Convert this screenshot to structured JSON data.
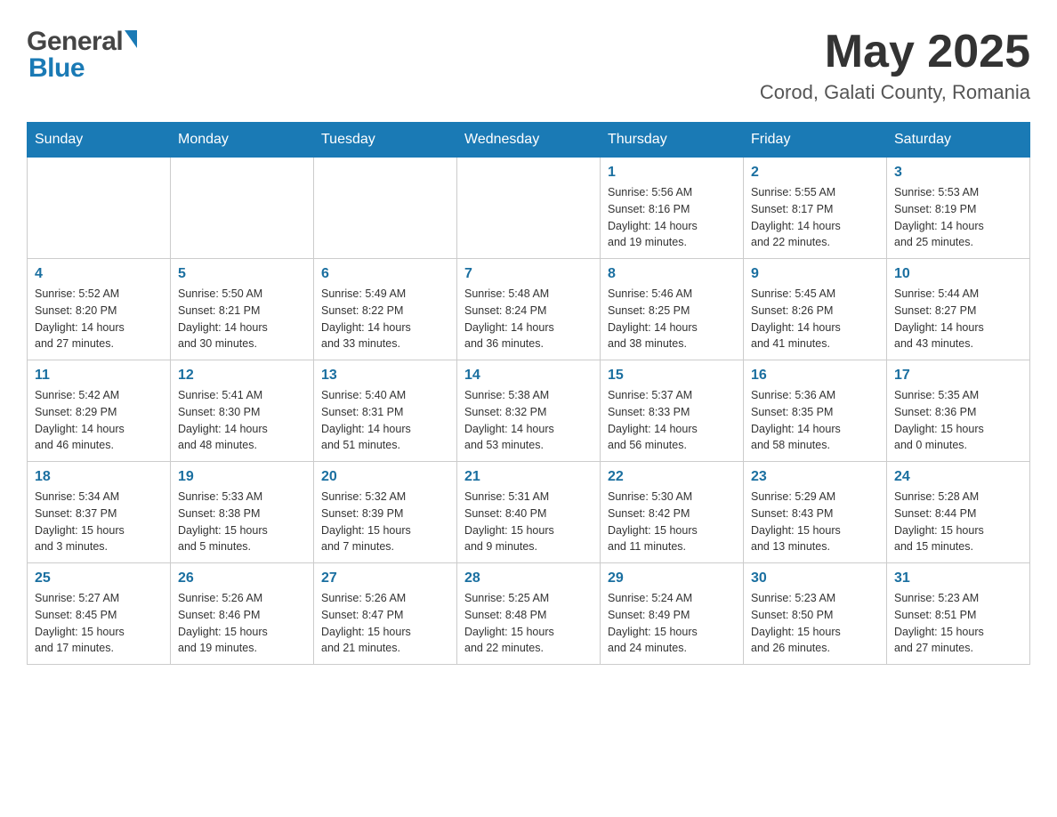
{
  "header": {
    "month_year": "May 2025",
    "location": "Corod, Galati County, Romania",
    "logo_general": "General",
    "logo_blue": "Blue"
  },
  "days_of_week": [
    "Sunday",
    "Monday",
    "Tuesday",
    "Wednesday",
    "Thursday",
    "Friday",
    "Saturday"
  ],
  "weeks": [
    [
      {
        "day": "",
        "info": ""
      },
      {
        "day": "",
        "info": ""
      },
      {
        "day": "",
        "info": ""
      },
      {
        "day": "",
        "info": ""
      },
      {
        "day": "1",
        "info": "Sunrise: 5:56 AM\nSunset: 8:16 PM\nDaylight: 14 hours\nand 19 minutes."
      },
      {
        "day": "2",
        "info": "Sunrise: 5:55 AM\nSunset: 8:17 PM\nDaylight: 14 hours\nand 22 minutes."
      },
      {
        "day": "3",
        "info": "Sunrise: 5:53 AM\nSunset: 8:19 PM\nDaylight: 14 hours\nand 25 minutes."
      }
    ],
    [
      {
        "day": "4",
        "info": "Sunrise: 5:52 AM\nSunset: 8:20 PM\nDaylight: 14 hours\nand 27 minutes."
      },
      {
        "day": "5",
        "info": "Sunrise: 5:50 AM\nSunset: 8:21 PM\nDaylight: 14 hours\nand 30 minutes."
      },
      {
        "day": "6",
        "info": "Sunrise: 5:49 AM\nSunset: 8:22 PM\nDaylight: 14 hours\nand 33 minutes."
      },
      {
        "day": "7",
        "info": "Sunrise: 5:48 AM\nSunset: 8:24 PM\nDaylight: 14 hours\nand 36 minutes."
      },
      {
        "day": "8",
        "info": "Sunrise: 5:46 AM\nSunset: 8:25 PM\nDaylight: 14 hours\nand 38 minutes."
      },
      {
        "day": "9",
        "info": "Sunrise: 5:45 AM\nSunset: 8:26 PM\nDaylight: 14 hours\nand 41 minutes."
      },
      {
        "day": "10",
        "info": "Sunrise: 5:44 AM\nSunset: 8:27 PM\nDaylight: 14 hours\nand 43 minutes."
      }
    ],
    [
      {
        "day": "11",
        "info": "Sunrise: 5:42 AM\nSunset: 8:29 PM\nDaylight: 14 hours\nand 46 minutes."
      },
      {
        "day": "12",
        "info": "Sunrise: 5:41 AM\nSunset: 8:30 PM\nDaylight: 14 hours\nand 48 minutes."
      },
      {
        "day": "13",
        "info": "Sunrise: 5:40 AM\nSunset: 8:31 PM\nDaylight: 14 hours\nand 51 minutes."
      },
      {
        "day": "14",
        "info": "Sunrise: 5:38 AM\nSunset: 8:32 PM\nDaylight: 14 hours\nand 53 minutes."
      },
      {
        "day": "15",
        "info": "Sunrise: 5:37 AM\nSunset: 8:33 PM\nDaylight: 14 hours\nand 56 minutes."
      },
      {
        "day": "16",
        "info": "Sunrise: 5:36 AM\nSunset: 8:35 PM\nDaylight: 14 hours\nand 58 minutes."
      },
      {
        "day": "17",
        "info": "Sunrise: 5:35 AM\nSunset: 8:36 PM\nDaylight: 15 hours\nand 0 minutes."
      }
    ],
    [
      {
        "day": "18",
        "info": "Sunrise: 5:34 AM\nSunset: 8:37 PM\nDaylight: 15 hours\nand 3 minutes."
      },
      {
        "day": "19",
        "info": "Sunrise: 5:33 AM\nSunset: 8:38 PM\nDaylight: 15 hours\nand 5 minutes."
      },
      {
        "day": "20",
        "info": "Sunrise: 5:32 AM\nSunset: 8:39 PM\nDaylight: 15 hours\nand 7 minutes."
      },
      {
        "day": "21",
        "info": "Sunrise: 5:31 AM\nSunset: 8:40 PM\nDaylight: 15 hours\nand 9 minutes."
      },
      {
        "day": "22",
        "info": "Sunrise: 5:30 AM\nSunset: 8:42 PM\nDaylight: 15 hours\nand 11 minutes."
      },
      {
        "day": "23",
        "info": "Sunrise: 5:29 AM\nSunset: 8:43 PM\nDaylight: 15 hours\nand 13 minutes."
      },
      {
        "day": "24",
        "info": "Sunrise: 5:28 AM\nSunset: 8:44 PM\nDaylight: 15 hours\nand 15 minutes."
      }
    ],
    [
      {
        "day": "25",
        "info": "Sunrise: 5:27 AM\nSunset: 8:45 PM\nDaylight: 15 hours\nand 17 minutes."
      },
      {
        "day": "26",
        "info": "Sunrise: 5:26 AM\nSunset: 8:46 PM\nDaylight: 15 hours\nand 19 minutes."
      },
      {
        "day": "27",
        "info": "Sunrise: 5:26 AM\nSunset: 8:47 PM\nDaylight: 15 hours\nand 21 minutes."
      },
      {
        "day": "28",
        "info": "Sunrise: 5:25 AM\nSunset: 8:48 PM\nDaylight: 15 hours\nand 22 minutes."
      },
      {
        "day": "29",
        "info": "Sunrise: 5:24 AM\nSunset: 8:49 PM\nDaylight: 15 hours\nand 24 minutes."
      },
      {
        "day": "30",
        "info": "Sunrise: 5:23 AM\nSunset: 8:50 PM\nDaylight: 15 hours\nand 26 minutes."
      },
      {
        "day": "31",
        "info": "Sunrise: 5:23 AM\nSunset: 8:51 PM\nDaylight: 15 hours\nand 27 minutes."
      }
    ]
  ]
}
